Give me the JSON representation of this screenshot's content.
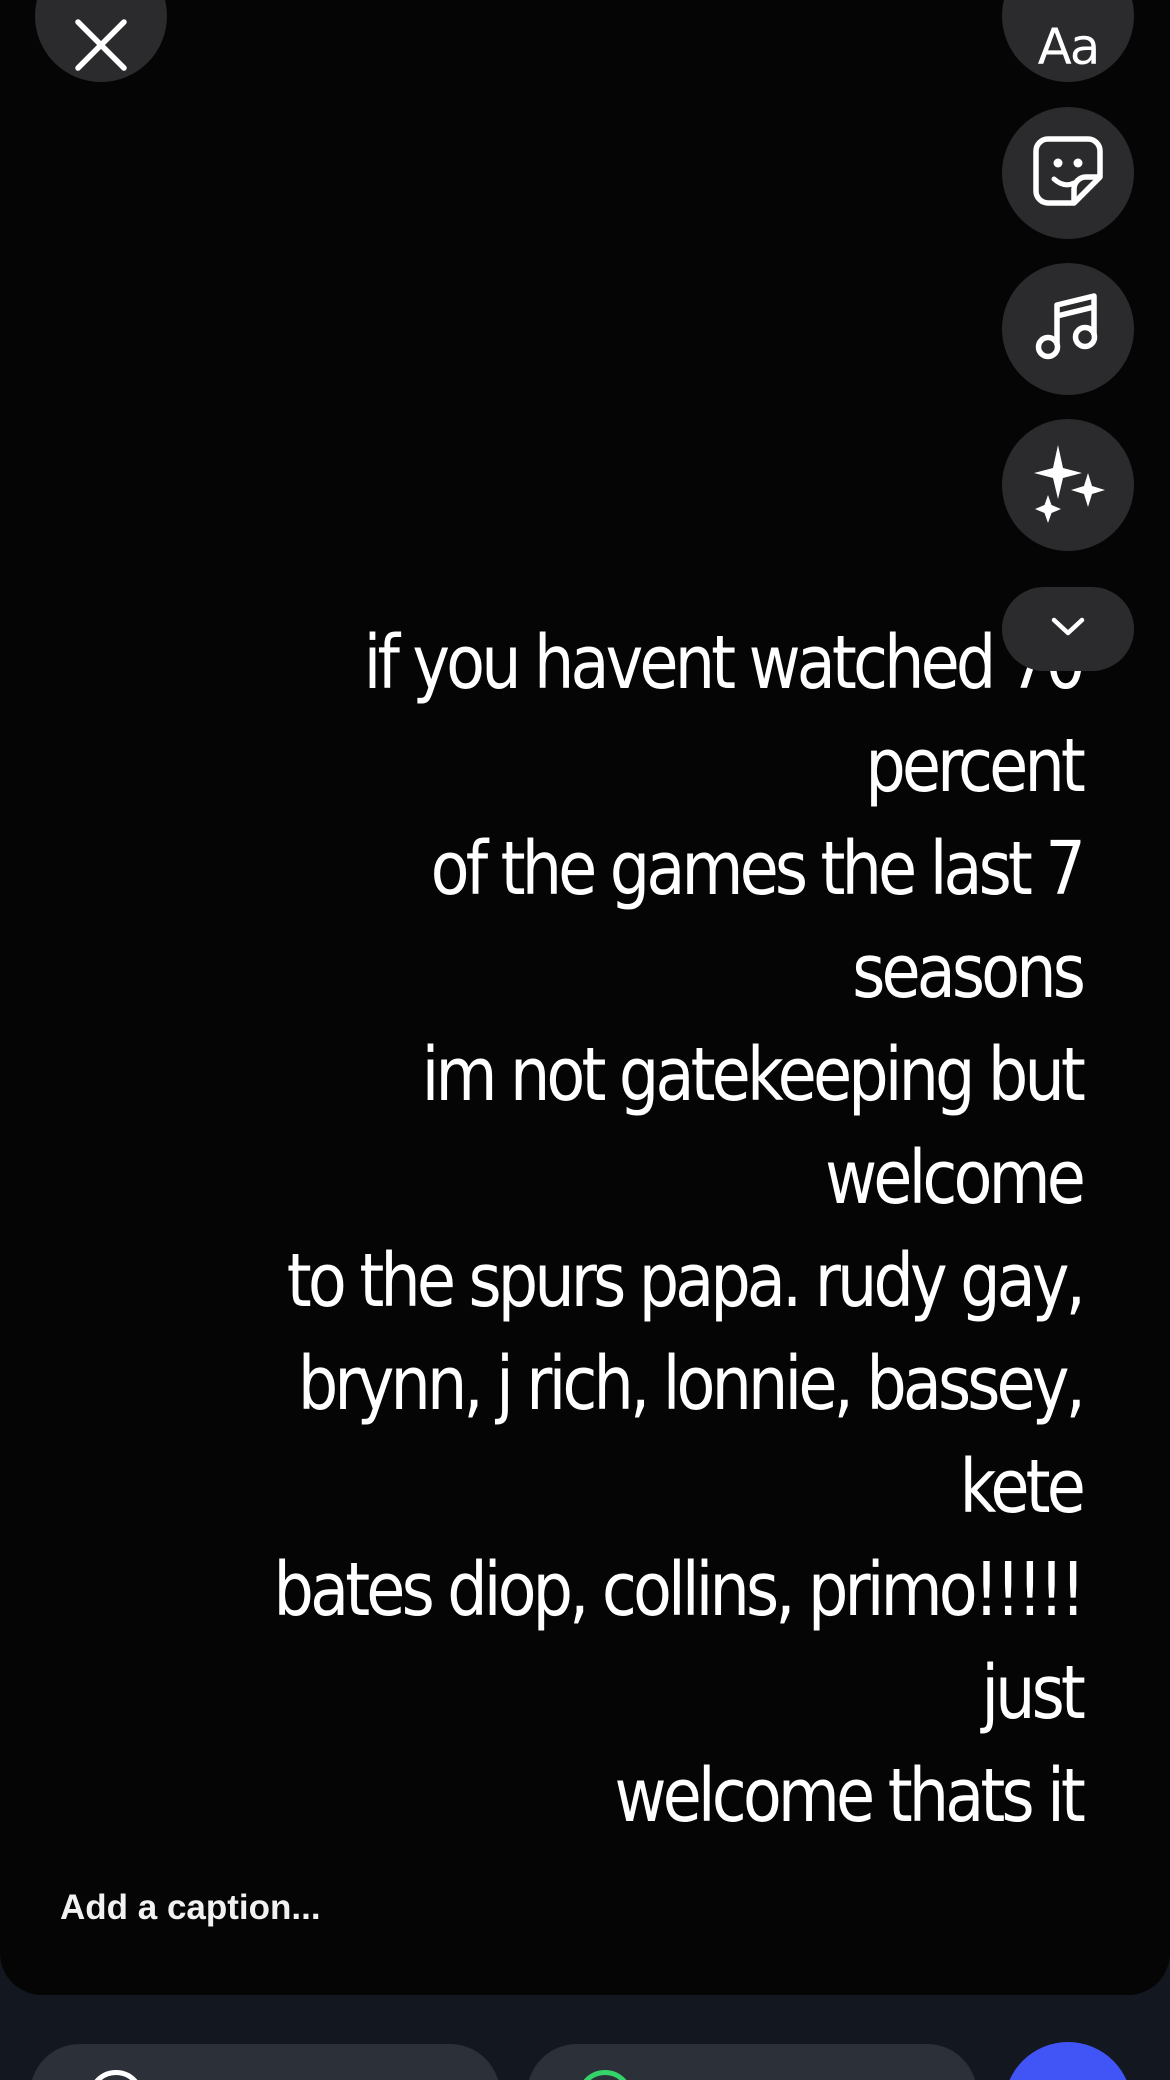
{
  "toolbar": {
    "text_tool_label": "Aa"
  },
  "story": {
    "text_lines": [
      "if you havent watched 70 percent",
      "of the games the last 7 seasons",
      "im not gatekeeping but welcome",
      "to the spurs papa. rudy gay,",
      "brynn, j rich, lonnie, bassey,  kete",
      "bates diop, collins, primo!!!!! just",
      "welcome thats it"
    ],
    "background_color": "#050506",
    "text_color": "#ffffff"
  },
  "caption": {
    "placeholder": "Add a caption..."
  },
  "colors": {
    "button_bg": "#2b2b2d",
    "send_button": "#4154f5",
    "bottom_bar": "#13171f",
    "status_ring_green": "#35d26a"
  }
}
